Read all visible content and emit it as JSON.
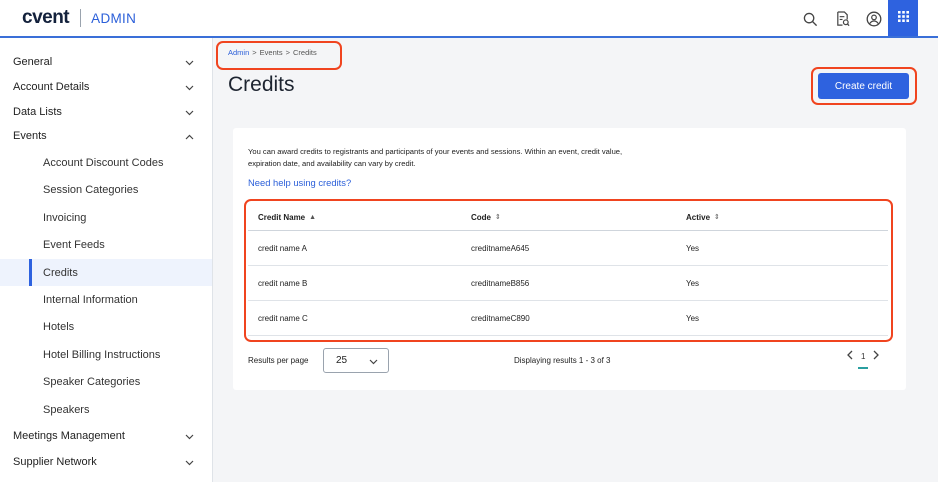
{
  "header": {
    "logo": "cvent",
    "section": "ADMIN",
    "icons": [
      "search-icon",
      "document-search-icon",
      "user-account-icon",
      "apps-grid-icon"
    ]
  },
  "sidebar": {
    "items": [
      {
        "label": "General",
        "level": 0,
        "chevron": "down"
      },
      {
        "label": "Account Details",
        "level": 0,
        "chevron": "down"
      },
      {
        "label": "Data Lists",
        "level": 0,
        "chevron": "down"
      },
      {
        "label": "Events",
        "level": 0,
        "chevron": "up"
      },
      {
        "label": "Account Discount Codes",
        "level": 1
      },
      {
        "label": "Session Categories",
        "level": 1
      },
      {
        "label": "Invoicing",
        "level": 1
      },
      {
        "label": "Event Feeds",
        "level": 1
      },
      {
        "label": "Credits",
        "level": 1,
        "active": true
      },
      {
        "label": "Internal Information",
        "level": 1
      },
      {
        "label": "Hotels",
        "level": 1
      },
      {
        "label": "Hotel Billing Instructions",
        "level": 1
      },
      {
        "label": "Speaker Categories",
        "level": 1
      },
      {
        "label": "Speakers",
        "level": 1
      },
      {
        "label": "Meetings Management",
        "level": 0,
        "chevron": "down"
      },
      {
        "label": "Supplier Network",
        "level": 0,
        "chevron": "down"
      }
    ]
  },
  "breadcrumb": {
    "items": [
      "Admin",
      "Events",
      "Credits"
    ],
    "separator": ">"
  },
  "page": {
    "title": "Credits",
    "create_button": "Create credit",
    "intro": "You can award credits to registrants and participants of your events and sessions. Within an event, credit value, expiration date, and availability can vary by credit.",
    "help_link": "Need help using credits?"
  },
  "table": {
    "columns": [
      {
        "label": "Credit Name",
        "sort": "▲"
      },
      {
        "label": "Code",
        "sort": "⇕"
      },
      {
        "label": "Active",
        "sort": "⇕"
      }
    ],
    "rows": [
      {
        "name": "credit name A",
        "code": "creditnameA645",
        "active": "Yes"
      },
      {
        "name": "credit name B",
        "code": "creditnameB856",
        "active": "Yes"
      },
      {
        "name": "credit name C",
        "code": "creditnameC890",
        "active": "Yes"
      }
    ]
  },
  "pagination": {
    "per_page_label": "Results per page",
    "per_page_value": "25",
    "results_text": "Displaying results 1 - 3 of 3",
    "current_page": "1"
  },
  "colors": {
    "accent": "#2e62df",
    "annotation": "#f0441f",
    "pager_underline": "#2a9fa0"
  }
}
